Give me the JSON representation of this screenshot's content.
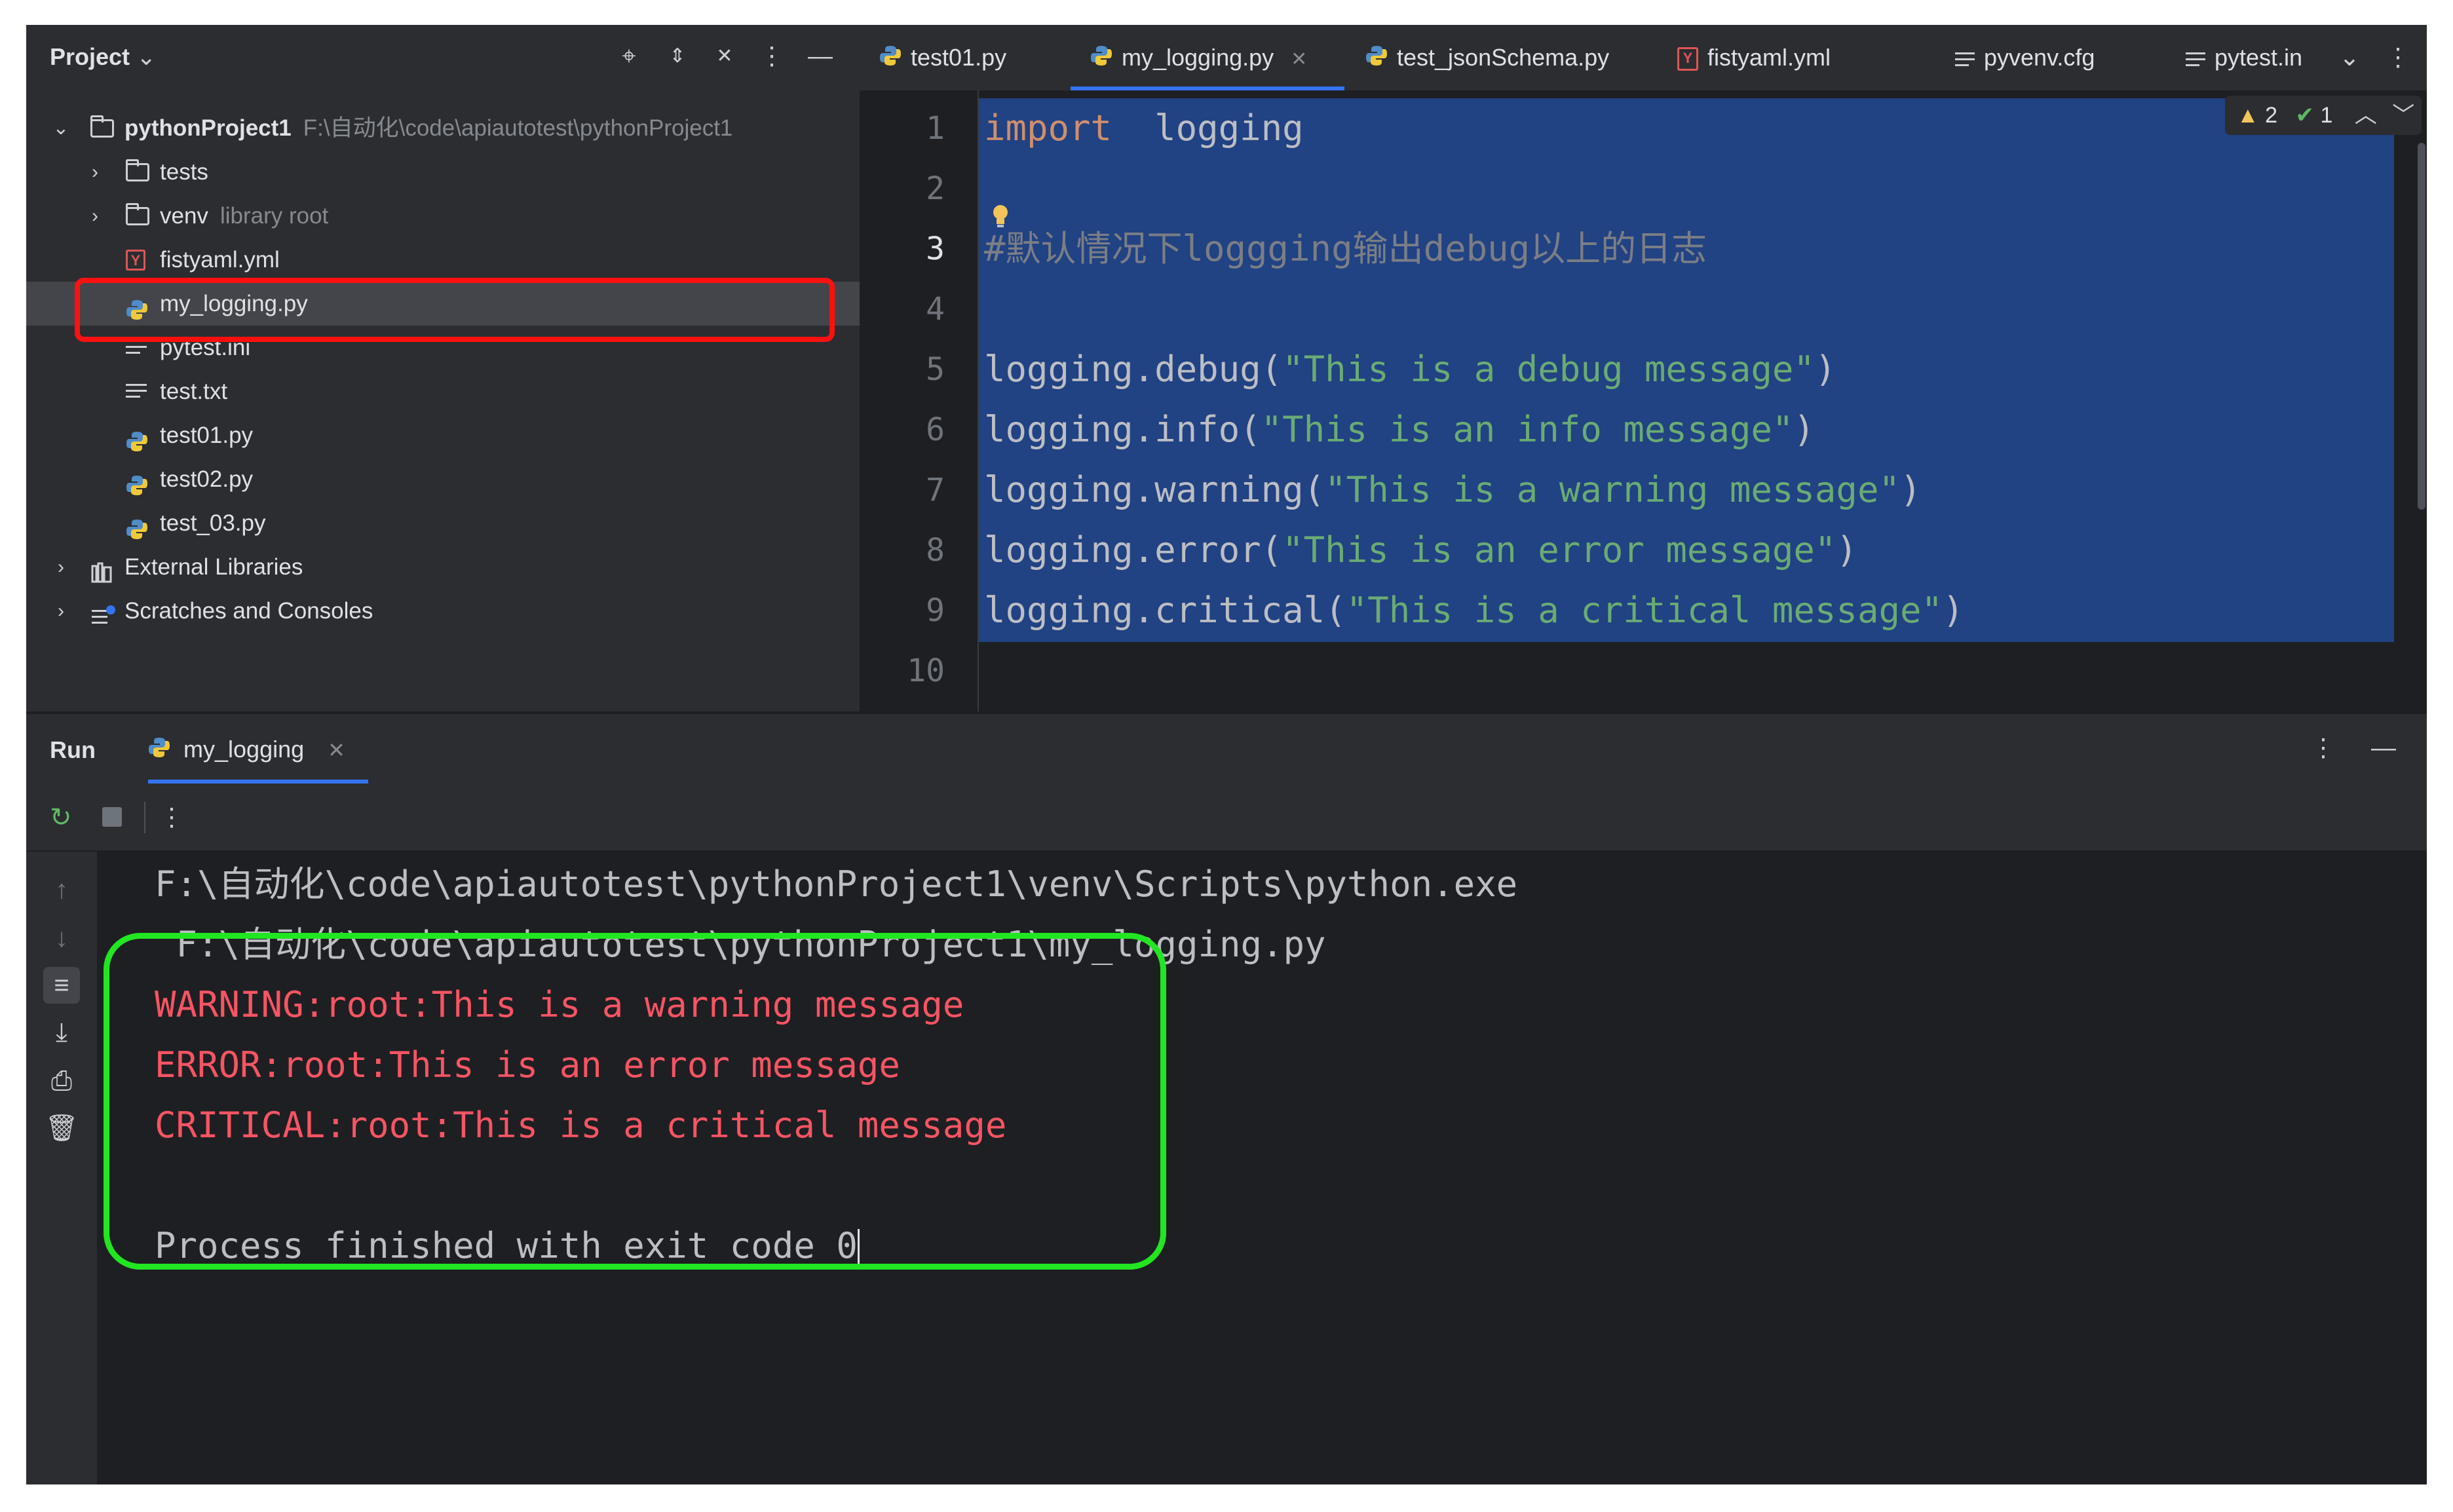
{
  "project_panel": {
    "title": "Project",
    "tree": [
      {
        "label": "pythonProject1",
        "hint": "F:\\自动化\\code\\apiautotest\\pythonProject1",
        "type": "folder",
        "level": 0,
        "expanded": true
      },
      {
        "label": "tests",
        "hint": "",
        "type": "folder",
        "level": 1,
        "expanded": false
      },
      {
        "label": "venv",
        "hint": "library root",
        "type": "folder",
        "level": 1,
        "expanded": false
      },
      {
        "label": "fistyaml.yml",
        "hint": "",
        "type": "yaml",
        "level": 1
      },
      {
        "label": "my_logging.py",
        "hint": "",
        "type": "python",
        "level": 1,
        "selected": true
      },
      {
        "label": "pytest.ini",
        "hint": "",
        "type": "text",
        "level": 1
      },
      {
        "label": "test.txt",
        "hint": "",
        "type": "text",
        "level": 1
      },
      {
        "label": "test01.py",
        "hint": "",
        "type": "python",
        "level": 1
      },
      {
        "label": "test02.py",
        "hint": "",
        "type": "python",
        "level": 1
      },
      {
        "label": "test_03.py",
        "hint": "",
        "type": "python",
        "level": 1
      },
      {
        "label": "External Libraries",
        "hint": "",
        "type": "library",
        "level": 0,
        "expanded": false
      },
      {
        "label": "Scratches and Consoles",
        "hint": "",
        "type": "scratch",
        "level": 0,
        "expanded": false
      }
    ]
  },
  "editor_tabs": [
    {
      "label": "test01.py",
      "type": "python"
    },
    {
      "label": "my_logging.py",
      "type": "python",
      "active": true,
      "closable": true
    },
    {
      "label": "test_jsonSchema.py",
      "type": "python"
    },
    {
      "label": "fistyaml.yml",
      "type": "yaml"
    },
    {
      "label": "pyvenv.cfg",
      "type": "text"
    },
    {
      "label": "pytest.in",
      "type": "text"
    }
  ],
  "inspections": {
    "warnings": "2",
    "ok": "1"
  },
  "code_lines": [
    {
      "n": "1",
      "parts": [
        {
          "t": "import",
          "c": "kw"
        },
        {
          "t": "  logging",
          "c": ""
        }
      ]
    },
    {
      "n": "2",
      "parts": []
    },
    {
      "n": "3",
      "parts": [
        {
          "t": "#默认情况下loggging输出debug以上的日志",
          "c": "cmt"
        }
      ]
    },
    {
      "n": "4",
      "parts": []
    },
    {
      "n": "5",
      "parts": [
        {
          "t": "logging.debug(",
          "c": ""
        },
        {
          "t": "\"This is a debug message\"",
          "c": "str"
        },
        {
          "t": ")",
          "c": ""
        }
      ]
    },
    {
      "n": "6",
      "parts": [
        {
          "t": "logging.info(",
          "c": ""
        },
        {
          "t": "\"This is an info message\"",
          "c": "str"
        },
        {
          "t": ")",
          "c": ""
        }
      ]
    },
    {
      "n": "7",
      "parts": [
        {
          "t": "logging.warning(",
          "c": ""
        },
        {
          "t": "\"This is a warning message\"",
          "c": "str"
        },
        {
          "t": ")",
          "c": ""
        }
      ]
    },
    {
      "n": "8",
      "parts": [
        {
          "t": "logging.error(",
          "c": ""
        },
        {
          "t": "\"This is an error message\"",
          "c": "str"
        },
        {
          "t": ")",
          "c": ""
        }
      ]
    },
    {
      "n": "9",
      "parts": [
        {
          "t": "logging.critical(",
          "c": ""
        },
        {
          "t": "\"This is a critical message\"",
          "c": "str"
        },
        {
          "t": ")",
          "c": ""
        }
      ]
    },
    {
      "n": "10",
      "parts": []
    }
  ],
  "run_panel": {
    "title": "Run",
    "tab_label": "my_logging",
    "console_lines": [
      {
        "text": "F:\\自动化\\code\\apiautotest\\pythonProject1\\venv\\Scripts\\python.exe",
        "kind": "normal"
      },
      {
        "text": " F:\\自动化\\code\\apiautotest\\pythonProject1\\my_logging.py",
        "kind": "normal"
      },
      {
        "text": "WARNING:root:This is a warning message",
        "kind": "err"
      },
      {
        "text": "ERROR:root:This is an error message",
        "kind": "err"
      },
      {
        "text": "CRITICAL:root:This is a critical message",
        "kind": "err"
      },
      {
        "text": "",
        "kind": "normal"
      },
      {
        "text": "Process finished with exit code 0",
        "kind": "normal",
        "cursor": true
      }
    ]
  },
  "colors": {
    "highlight_red": "#ff1010",
    "highlight_green": "#22e622",
    "accent": "#3574f0",
    "error_text": "#f75464"
  }
}
